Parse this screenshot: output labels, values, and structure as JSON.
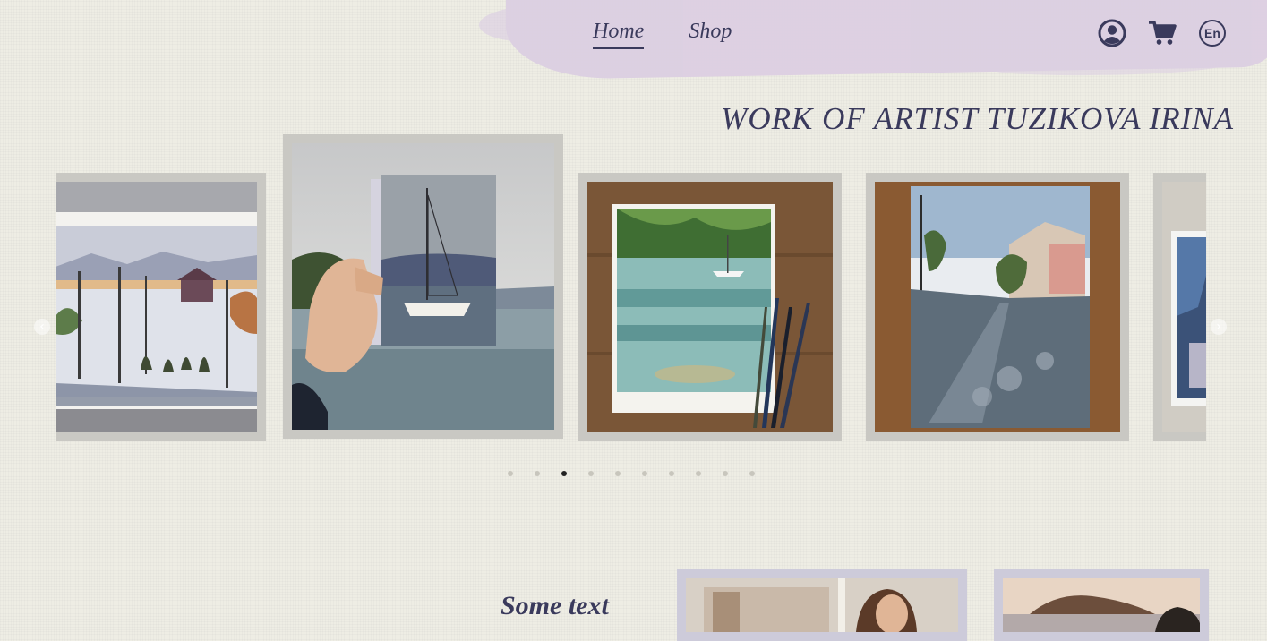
{
  "header": {
    "nav": [
      {
        "label": "Home",
        "active": true
      },
      {
        "label": "Shop",
        "active": false
      }
    ],
    "icons": [
      "user-account-icon",
      "shopping-cart-icon",
      "language-icon"
    ],
    "language": "En"
  },
  "page_title": "WORK OF ARTIST TUZIKOVA IRINA",
  "carousel": {
    "slides": [
      {
        "subject": "lake-houses-watercolor"
      },
      {
        "subject": "sailboat-watercolor-in-hand"
      },
      {
        "subject": "green-bay-watercolor-with-brushes"
      },
      {
        "subject": "street-watercolor"
      },
      {
        "subject": "blue-watercolor"
      }
    ],
    "dots_count": 10,
    "active_dot": 3,
    "prev_icon": "chevron-left-icon",
    "next_icon": "chevron-right-icon"
  },
  "section": {
    "title": "Some text"
  },
  "colors": {
    "text": "#3a3a5c",
    "brush": "#dccfe2",
    "frame": "#c9c8c3",
    "background": "#eeede4"
  }
}
